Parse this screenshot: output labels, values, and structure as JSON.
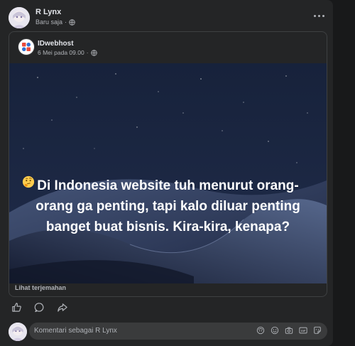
{
  "post": {
    "author_name": "R Lynx",
    "timestamp": "Baru saja",
    "privacy_icon": "globe-icon",
    "more_icon": "more-horizontal-icon"
  },
  "shared_post": {
    "page_name": "IDwebhost",
    "timestamp": "6 Mei pada 09.00",
    "privacy_icon": "globe-icon",
    "image_text": "Di Indonesia website tuh menurut orang-orang ga penting, tapi kalo diluar penting banget buat bisnis. Kira-kira, kenapa?",
    "image_emoji": "thinking-face-emoji",
    "see_translation": "Lihat terjemahan"
  },
  "actions": {
    "icons": [
      "like-icon",
      "comment-icon",
      "share-icon"
    ]
  },
  "comment": {
    "placeholder": "Komentari sebagai R Lynx",
    "tools": [
      "avatar-sticker-icon",
      "emoji-icon",
      "camera-icon",
      "gif-icon",
      "sticker-icon"
    ]
  },
  "colors": {
    "background": "#18191a",
    "card": "#242526",
    "input": "#3a3b3c",
    "primary_text": "#e4e6eb",
    "secondary_text": "#b0b3b8"
  }
}
